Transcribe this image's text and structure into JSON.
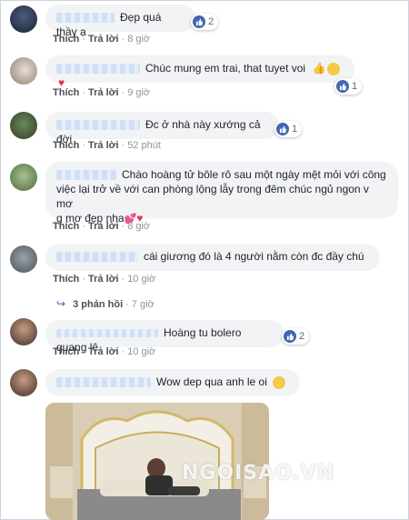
{
  "comments": [
    {
      "text": "Đẹp quá thầy ạ",
      "like_label": "Thích",
      "reply_label": "Trả lời",
      "time": "8 giờ",
      "reactions": "2"
    },
    {
      "text": "Chúc mung em trai, that tuyet voi",
      "like_label": "Thích",
      "reply_label": "Trả lời",
      "time": "9 giờ",
      "reactions": "1"
    },
    {
      "text": "Đc ở nhà này xướng cả đời",
      "like_label": "Thích",
      "reply_label": "Trả lời",
      "time": "52 phút",
      "reactions": "1"
    },
    {
      "text": "Chào hoàng tử bôle rô sau một ngày mệt mỏi với công việc lại trở về với can phòng lộng lẫy trong đêm chúc ngủ ngon v mơ g mơ đẹp nha",
      "line1": "Chào hoàng tử bôle rô sau một ngày mệt mỏi với công",
      "line2": "việc lại trở về với can phòng lộng lẫy trong đêm chúc ngủ ngon v mơ",
      "line3": "g mơ đẹp nha",
      "like_label": "Thích",
      "reply_label": "Trả lời",
      "time": "8 giờ"
    },
    {
      "text": "cái giương đó là 4 người nằm còn đc đầy chú",
      "like_label": "Thích",
      "reply_label": "Trả lời",
      "time": "10 giờ",
      "replies": "3 phản hồi",
      "replies_time": "7 giờ"
    },
    {
      "text": "Hoàng tu bolero quang lê",
      "like_label": "Thích",
      "reply_label": "Trả lời",
      "time": "10 giờ",
      "reactions": "2"
    },
    {
      "text": "Wow dep qua anh le oi"
    }
  ],
  "watermark": "NGOISAO.VN",
  "colors": {
    "link": "#4267b2",
    "bubble": "#f2f3f5",
    "meta": "#90949c"
  }
}
